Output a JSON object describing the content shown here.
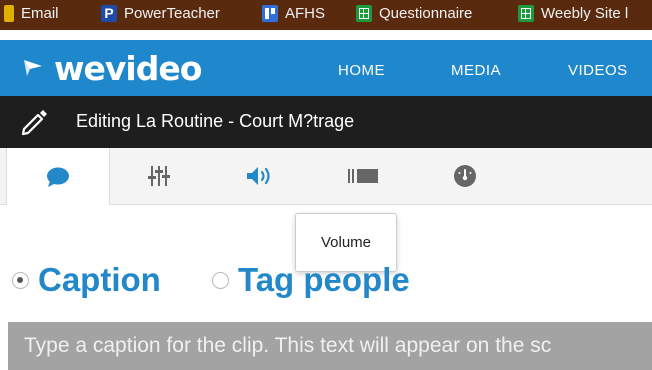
{
  "bookmarks": [
    {
      "label": "Email",
      "icon": "mail-icon"
    },
    {
      "label": "PowerTeacher",
      "icon": "powerteacher-icon"
    },
    {
      "label": "AFHS",
      "icon": "board-icon"
    },
    {
      "label": "Questionnaire",
      "icon": "sheets-icon"
    },
    {
      "label": "Weebly Site l",
      "icon": "sheets-icon"
    }
  ],
  "header": {
    "logo": "wevideo",
    "nav": [
      "HOME",
      "MEDIA",
      "VIDEOS"
    ]
  },
  "editbar": {
    "title": "Editing La Routine - Court M?trage"
  },
  "tabs": [
    {
      "name": "caption",
      "icon": "speech-bubble-icon",
      "active": true
    },
    {
      "name": "mixer",
      "icon": "mixer-sliders-icon",
      "active": false
    },
    {
      "name": "volume",
      "icon": "speaker-volume-icon",
      "active": false
    },
    {
      "name": "clip",
      "icon": "film-clip-icon",
      "active": false
    },
    {
      "name": "speed",
      "icon": "speedometer-icon",
      "active": false
    }
  ],
  "tooltip": {
    "text": "Volume"
  },
  "options": {
    "caption_label": "Caption",
    "tag_people_label": "Tag people",
    "selected": "Caption"
  },
  "caption": {
    "placeholder": "Type a caption for the clip. This text will appear on the sc"
  },
  "colors": {
    "brand_blue": "#1f88cc",
    "option_blue": "#2288c9",
    "editbar_bg": "#1e1e1e",
    "bookmarks_bg": "#5a2a0f"
  }
}
